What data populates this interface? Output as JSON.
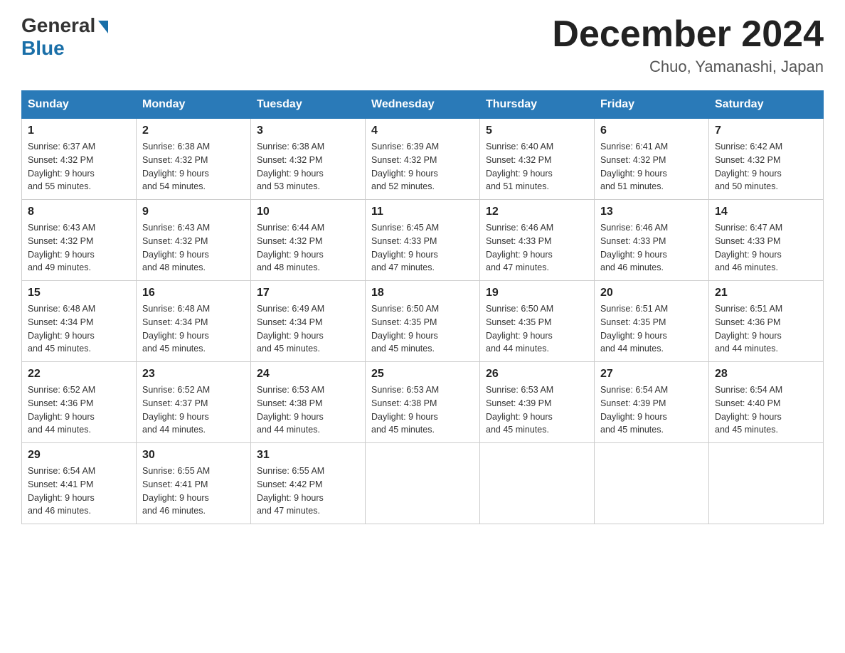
{
  "logo": {
    "general": "General",
    "blue": "Blue"
  },
  "title": "December 2024",
  "location": "Chuo, Yamanashi, Japan",
  "days_header": [
    "Sunday",
    "Monday",
    "Tuesday",
    "Wednesday",
    "Thursday",
    "Friday",
    "Saturday"
  ],
  "weeks": [
    [
      {
        "day": "1",
        "sunrise": "6:37 AM",
        "sunset": "4:32 PM",
        "daylight": "9 hours and 55 minutes."
      },
      {
        "day": "2",
        "sunrise": "6:38 AM",
        "sunset": "4:32 PM",
        "daylight": "9 hours and 54 minutes."
      },
      {
        "day": "3",
        "sunrise": "6:38 AM",
        "sunset": "4:32 PM",
        "daylight": "9 hours and 53 minutes."
      },
      {
        "day": "4",
        "sunrise": "6:39 AM",
        "sunset": "4:32 PM",
        "daylight": "9 hours and 52 minutes."
      },
      {
        "day": "5",
        "sunrise": "6:40 AM",
        "sunset": "4:32 PM",
        "daylight": "9 hours and 51 minutes."
      },
      {
        "day": "6",
        "sunrise": "6:41 AM",
        "sunset": "4:32 PM",
        "daylight": "9 hours and 51 minutes."
      },
      {
        "day": "7",
        "sunrise": "6:42 AM",
        "sunset": "4:32 PM",
        "daylight": "9 hours and 50 minutes."
      }
    ],
    [
      {
        "day": "8",
        "sunrise": "6:43 AM",
        "sunset": "4:32 PM",
        "daylight": "9 hours and 49 minutes."
      },
      {
        "day": "9",
        "sunrise": "6:43 AM",
        "sunset": "4:32 PM",
        "daylight": "9 hours and 48 minutes."
      },
      {
        "day": "10",
        "sunrise": "6:44 AM",
        "sunset": "4:32 PM",
        "daylight": "9 hours and 48 minutes."
      },
      {
        "day": "11",
        "sunrise": "6:45 AM",
        "sunset": "4:33 PM",
        "daylight": "9 hours and 47 minutes."
      },
      {
        "day": "12",
        "sunrise": "6:46 AM",
        "sunset": "4:33 PM",
        "daylight": "9 hours and 47 minutes."
      },
      {
        "day": "13",
        "sunrise": "6:46 AM",
        "sunset": "4:33 PM",
        "daylight": "9 hours and 46 minutes."
      },
      {
        "day": "14",
        "sunrise": "6:47 AM",
        "sunset": "4:33 PM",
        "daylight": "9 hours and 46 minutes."
      }
    ],
    [
      {
        "day": "15",
        "sunrise": "6:48 AM",
        "sunset": "4:34 PM",
        "daylight": "9 hours and 45 minutes."
      },
      {
        "day": "16",
        "sunrise": "6:48 AM",
        "sunset": "4:34 PM",
        "daylight": "9 hours and 45 minutes."
      },
      {
        "day": "17",
        "sunrise": "6:49 AM",
        "sunset": "4:34 PM",
        "daylight": "9 hours and 45 minutes."
      },
      {
        "day": "18",
        "sunrise": "6:50 AM",
        "sunset": "4:35 PM",
        "daylight": "9 hours and 45 minutes."
      },
      {
        "day": "19",
        "sunrise": "6:50 AM",
        "sunset": "4:35 PM",
        "daylight": "9 hours and 44 minutes."
      },
      {
        "day": "20",
        "sunrise": "6:51 AM",
        "sunset": "4:35 PM",
        "daylight": "9 hours and 44 minutes."
      },
      {
        "day": "21",
        "sunrise": "6:51 AM",
        "sunset": "4:36 PM",
        "daylight": "9 hours and 44 minutes."
      }
    ],
    [
      {
        "day": "22",
        "sunrise": "6:52 AM",
        "sunset": "4:36 PM",
        "daylight": "9 hours and 44 minutes."
      },
      {
        "day": "23",
        "sunrise": "6:52 AM",
        "sunset": "4:37 PM",
        "daylight": "9 hours and 44 minutes."
      },
      {
        "day": "24",
        "sunrise": "6:53 AM",
        "sunset": "4:38 PM",
        "daylight": "9 hours and 44 minutes."
      },
      {
        "day": "25",
        "sunrise": "6:53 AM",
        "sunset": "4:38 PM",
        "daylight": "9 hours and 45 minutes."
      },
      {
        "day": "26",
        "sunrise": "6:53 AM",
        "sunset": "4:39 PM",
        "daylight": "9 hours and 45 minutes."
      },
      {
        "day": "27",
        "sunrise": "6:54 AM",
        "sunset": "4:39 PM",
        "daylight": "9 hours and 45 minutes."
      },
      {
        "day": "28",
        "sunrise": "6:54 AM",
        "sunset": "4:40 PM",
        "daylight": "9 hours and 45 minutes."
      }
    ],
    [
      {
        "day": "29",
        "sunrise": "6:54 AM",
        "sunset": "4:41 PM",
        "daylight": "9 hours and 46 minutes."
      },
      {
        "day": "30",
        "sunrise": "6:55 AM",
        "sunset": "4:41 PM",
        "daylight": "9 hours and 46 minutes."
      },
      {
        "day": "31",
        "sunrise": "6:55 AM",
        "sunset": "4:42 PM",
        "daylight": "9 hours and 47 minutes."
      },
      null,
      null,
      null,
      null
    ]
  ],
  "labels": {
    "sunrise": "Sunrise:",
    "sunset": "Sunset:",
    "daylight": "Daylight:"
  }
}
